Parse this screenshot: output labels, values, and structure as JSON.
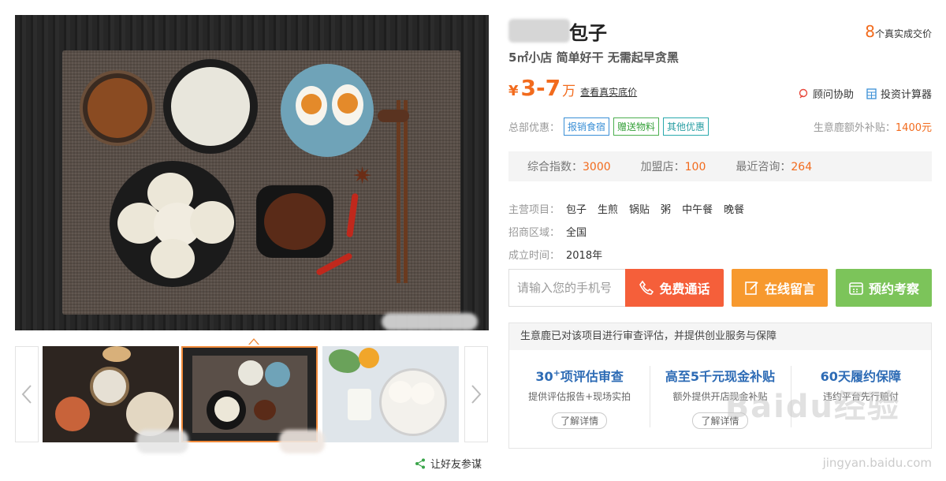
{
  "product": {
    "title": "包子",
    "slogan": "5㎡小店 简单好干 无需起早贪黑",
    "deals": {
      "count": "8",
      "label": "个真实成交价"
    },
    "price": {
      "currency": "¥",
      "range": "3-7",
      "unit": "万",
      "link": "查看真实底价"
    }
  },
  "tools": [
    {
      "label": "顾问协助",
      "icon": "consultant-icon"
    },
    {
      "label": "投资计算器",
      "icon": "calculator-icon"
    }
  ],
  "promo": {
    "label": "总部优惠：",
    "tags": [
      "报销食宿",
      "赠送物料",
      "其他优惠"
    ],
    "subsidy_label": "生意鹿额外补贴：",
    "subsidy_value": "1400元"
  },
  "stats": [
    {
      "label": "综合指数：",
      "value": "3000"
    },
    {
      "label": "加盟店：",
      "value": "100"
    },
    {
      "label": "最近咨询：",
      "value": "264"
    }
  ],
  "attributes": {
    "projects_label": "主营项目：",
    "projects": [
      "包子",
      "生煎",
      "锅贴",
      "粥",
      "中午餐",
      "晚餐"
    ],
    "region_label": "招商区域：",
    "region": "全国",
    "founded_label": "成立时间：",
    "founded": "2018年"
  },
  "contact": {
    "phone_placeholder": "请输入您的手机号",
    "call_label": "免费通话",
    "message_label": "在线留言",
    "visit_label": "预约考察"
  },
  "guarantee": {
    "header": "生意鹿已对该项目进行审查评估，并提供创业服务与保障",
    "items": [
      {
        "title": "30",
        "sup": "+",
        "title_rest": "项评估审查",
        "desc": "提供评估报告+现场实拍",
        "more": "了解详情"
      },
      {
        "title": "高至5千元现金补贴",
        "desc": "额外提供开店现金补贴",
        "more": "了解详情"
      },
      {
        "title": "60天履约保障",
        "desc": "违约平台先行赔付"
      }
    ]
  },
  "share_label": "让好友参谋",
  "watermark": {
    "brand": "Baidu经验",
    "url": "jingyan.baidu.com"
  },
  "colors": {
    "accent": "#f26b1d",
    "call": "#f55f3a",
    "message": "#f7992e",
    "visit": "#7cc45a",
    "link_blue": "#2d6bb5"
  }
}
